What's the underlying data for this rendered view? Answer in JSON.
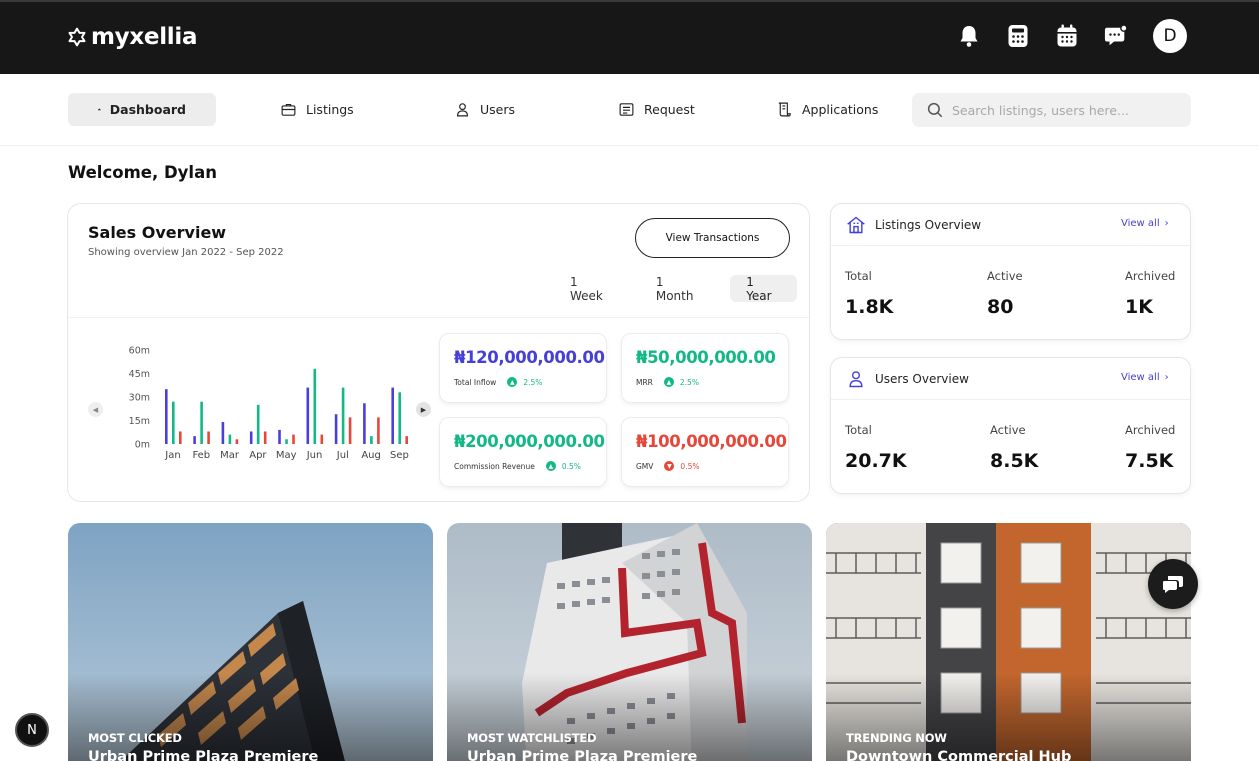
{
  "app": {
    "logo_text": "myxellia",
    "avatar_initial": "D"
  },
  "top_icons": [
    "bell-icon",
    "calculator-icon",
    "calendar-icon",
    "chat-icon"
  ],
  "nav": {
    "items": [
      {
        "label": "Dashboard",
        "icon": "home-icon",
        "active": true
      },
      {
        "label": "Listings",
        "icon": "briefcase-icon"
      },
      {
        "label": "Users",
        "icon": "user-icon"
      },
      {
        "label": "Request",
        "icon": "request-icon"
      },
      {
        "label": "Applications",
        "icon": "applications-icon"
      }
    ],
    "search_placeholder": "Search listings, users here..."
  },
  "welcome": "Welcome, Dylan",
  "sales": {
    "title": "Sales Overview",
    "subtitle": "Showing overview Jan 2022 - Sep 2022",
    "view_button": "View Transactions",
    "periods": [
      "1 Week",
      "1 Month",
      "1 Year"
    ],
    "active_period": "1 Year",
    "stats": [
      {
        "value": "₦120,000,000.00",
        "label": "Total Inflow",
        "change": "2.5%",
        "trend": "up",
        "color": "#4640d6"
      },
      {
        "value": "₦50,000,000.00",
        "label": "MRR",
        "change": "2.5%",
        "trend": "up",
        "color": "#12b886"
      },
      {
        "value": "₦200,000,000.00",
        "label": "Commission Revenue",
        "change": "0.5%",
        "trend": "up",
        "color": "#12b886"
      },
      {
        "value": "₦100,000,000.00",
        "label": "GMV",
        "change": "0.5%",
        "trend": "down",
        "color": "#e5483b"
      }
    ]
  },
  "chart_data": {
    "type": "bar",
    "categories": [
      "Jan",
      "Feb",
      "Mar",
      "Apr",
      "May",
      "Jun",
      "Jul",
      "Aug",
      "Sep"
    ],
    "y_ticks": [
      "0m",
      "15m",
      "30m",
      "45m",
      "60m"
    ],
    "ylim": [
      0,
      60
    ],
    "series": [
      {
        "color": "#4b3fdc",
        "values": [
          35,
          5,
          14,
          8,
          9,
          36,
          19,
          26,
          36
        ]
      },
      {
        "color": "#12b886",
        "values": [
          27,
          27,
          6,
          25,
          3,
          48,
          36,
          5,
          33
        ]
      },
      {
        "color": "#e5483b",
        "values": [
          8,
          8,
          3,
          8,
          6,
          6,
          17,
          17,
          5
        ]
      }
    ]
  },
  "listings_overview": {
    "title": "Listings Overview",
    "link": "View all",
    "stats": [
      {
        "label": "Total",
        "value": "1.8K"
      },
      {
        "label": "Active",
        "value": "80"
      },
      {
        "label": "Archived",
        "value": "1K"
      }
    ]
  },
  "users_overview": {
    "title": "Users Overview",
    "link": "View all",
    "stats": [
      {
        "label": "Total",
        "value": "20.7K"
      },
      {
        "label": "Active",
        "value": "8.5K"
      },
      {
        "label": "Archived",
        "value": "7.5K"
      }
    ]
  },
  "features": [
    {
      "tag": "MOST CLICKED",
      "name": "Urban Prime Plaza Premiere"
    },
    {
      "tag": "MOST WATCHLISTED",
      "name": "Urban Prime Plaza Premiere"
    },
    {
      "tag": "TRENDING NOW",
      "name": "Downtown Commercial Hub"
    }
  ],
  "dev_badge": "N"
}
